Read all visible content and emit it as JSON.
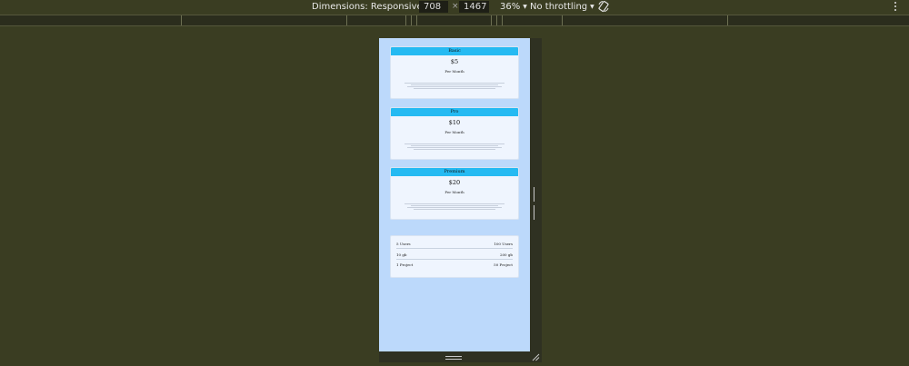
{
  "toolbar": {
    "dimensions_label": "Dimensions: Responsive",
    "width_value": "708",
    "times_sign": "×",
    "height_value": "1467",
    "zoom_label": "36%",
    "throttle_label": "No throttling",
    "rotate_icon": "rotate-icon",
    "more_icon": "kebab-menu-icon"
  },
  "pricing": {
    "plans": [
      {
        "name": "Basic",
        "price": "$5",
        "period": "Per Month"
      },
      {
        "name": "Pro",
        "price": "$10",
        "period": "Per Month"
      },
      {
        "name": "Premium",
        "price": "$20",
        "period": "Per Month"
      }
    ],
    "comparison": [
      {
        "left": "5 Users",
        "right": "100 Users"
      },
      {
        "left": "10 gb",
        "right": "200 gb"
      },
      {
        "left": "1 Project",
        "right": "50 Project"
      }
    ]
  },
  "colors": {
    "page_background": "#3a3d22",
    "viewport_background": "#bcd9fb",
    "card_header": "#25baf2",
    "card_body": "#eff5fe"
  }
}
